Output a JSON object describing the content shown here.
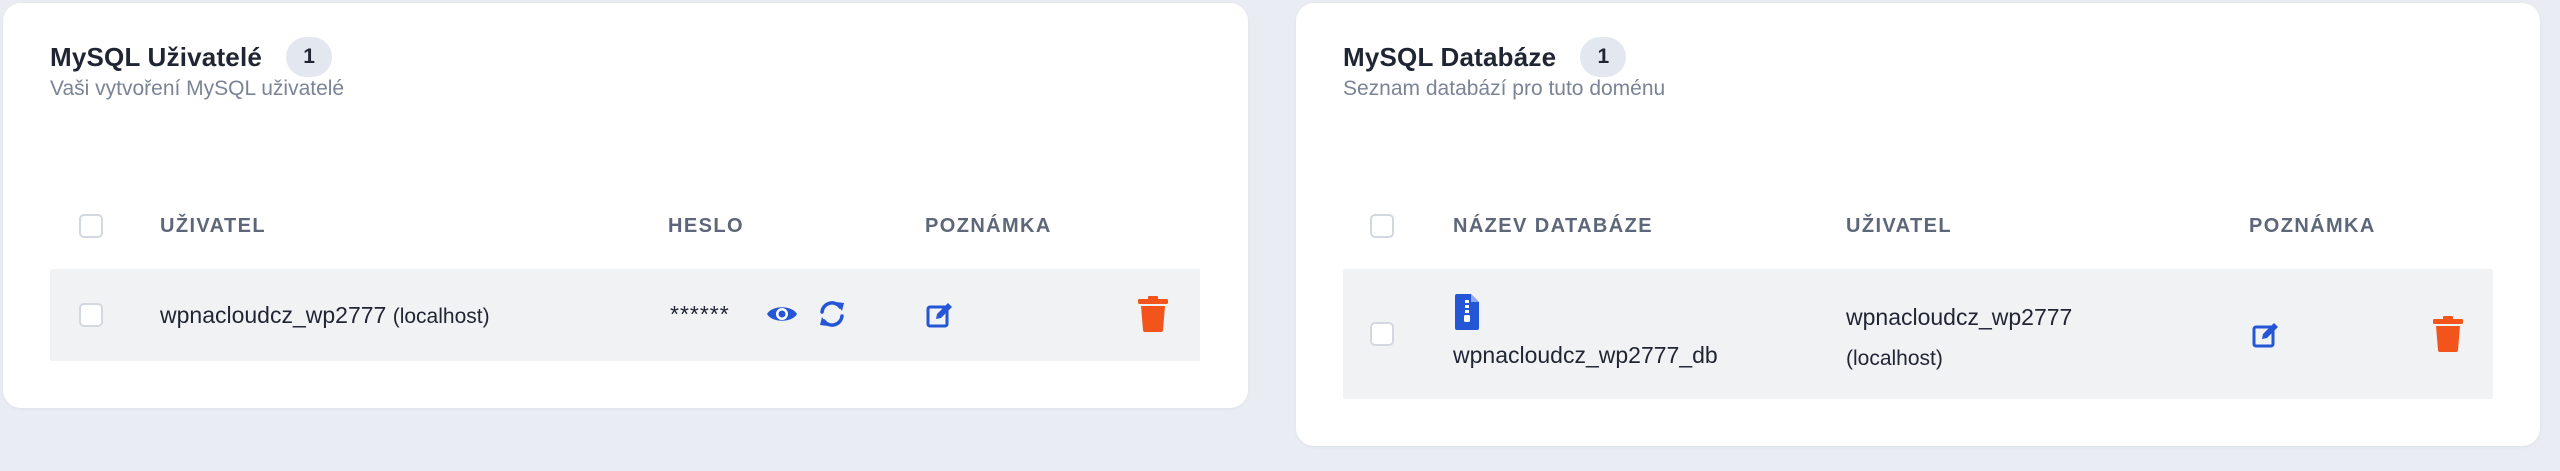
{
  "users_card": {
    "title": "MySQL Uživatelé",
    "count": "1",
    "subtitle": "Vaši vytvoření MySQL uživatelé",
    "columns": {
      "user": "UŽIVATEL",
      "password": "HESLO",
      "note": "POZNÁMKA"
    },
    "rows": [
      {
        "user": "wpnacloudcz_wp2777",
        "host": "(localhost)",
        "password_mask": "******"
      }
    ]
  },
  "db_card": {
    "title": "MySQL Databáze",
    "count": "1",
    "subtitle": "Seznam databází pro tuto doménu",
    "columns": {
      "name": "NÁZEV DATABÁZE",
      "user": "UŽIVATEL",
      "note": "POZNÁMKA"
    },
    "rows": [
      {
        "name": "wpnacloudcz_wp2777_db",
        "user": "wpnacloudcz_wp2777",
        "host": "(localhost)"
      }
    ]
  },
  "colors": {
    "accent_blue": "#2456d6",
    "delete_orange": "#f2541c",
    "background": "#e9edf3"
  },
  "icons": {
    "reveal": "eye-icon",
    "regenerate": "refresh-icon",
    "edit": "edit-note-icon",
    "delete": "trash-icon",
    "db_file": "database-file-icon"
  }
}
